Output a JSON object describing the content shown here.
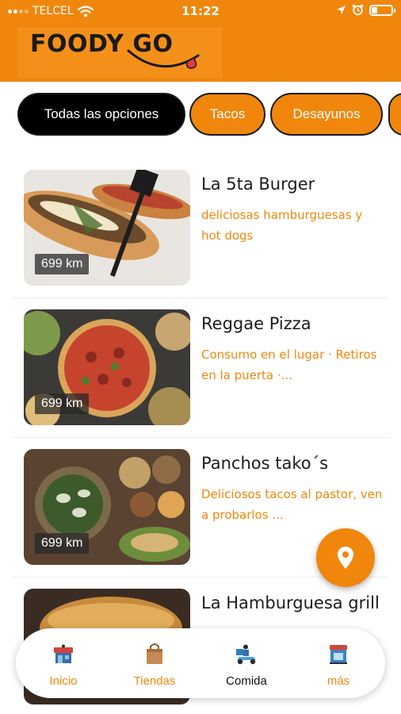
{
  "status_bar": {
    "carrier": "TELCEL",
    "time": "11:22",
    "battery_level": 0.3,
    "icons": [
      "wifi-icon",
      "location-arrow-icon",
      "alarm-icon",
      "battery-icon"
    ]
  },
  "header": {
    "logo_text": "FOODY GO",
    "colors": {
      "brand": "#f0870c",
      "dark": "#000000"
    }
  },
  "categories": [
    {
      "label": "Todas las opciones",
      "selected": true
    },
    {
      "label": "Tacos",
      "selected": false
    },
    {
      "label": "Desayunos",
      "selected": false
    },
    {
      "label": "",
      "selected": false
    }
  ],
  "restaurants": [
    {
      "name": "La 5ta Burger",
      "description": "deliciosas hamburguesas y hot dogs",
      "distance": "699 km"
    },
    {
      "name": "Reggae Pizza",
      "description": "Consumo en el lugar · Retiros en la puerta ·...",
      "distance": "699 km"
    },
    {
      "name": "Panchos tako´s",
      "description": "Deliciosos tacos al pastor, ven a probarlos ...",
      "distance": "699 km"
    },
    {
      "name": "La Hamburguesa grill",
      "description": "",
      "distance": ""
    }
  ],
  "fab": {
    "icon": "map-pin-icon"
  },
  "bottom_nav": [
    {
      "label": "Inicio",
      "icon": "home-store-icon",
      "current": false
    },
    {
      "label": "Tiendas",
      "icon": "shopping-bag-icon",
      "current": false
    },
    {
      "label": "Comida",
      "icon": "delivery-scooter-icon",
      "current": true
    },
    {
      "label": "más",
      "icon": "shop-front-icon",
      "current": false
    }
  ]
}
